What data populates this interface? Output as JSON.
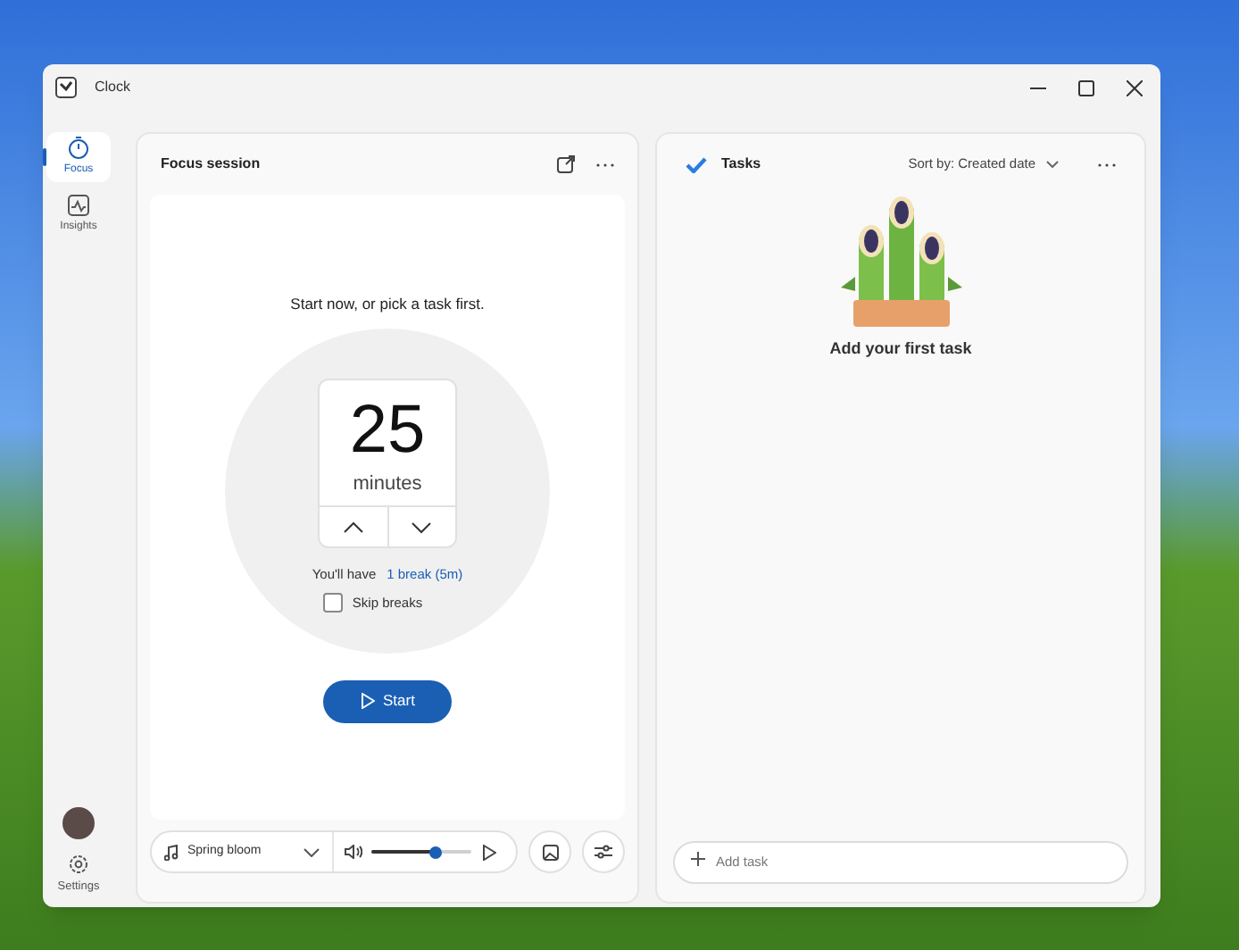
{
  "window": {
    "title": "Clock"
  },
  "nav": [
    {
      "label": "Focus",
      "selected": true
    },
    {
      "label": "Insights",
      "selected": false
    }
  ],
  "nav_footer": {
    "settings_label": "Settings"
  },
  "focus": {
    "title": "Focus session",
    "prompt": "Start now, or pick a task first.",
    "minutes": "25",
    "unit": "minutes",
    "break_prefix": "You'll have",
    "break_link": "1 break (5m)",
    "skip_breaks": {
      "label": "Skip breaks",
      "checked": false
    },
    "start_label": "Start"
  },
  "player": {
    "track": "Spring bloom",
    "volume": {
      "level": 0.65
    }
  },
  "tasks": {
    "title": "Tasks",
    "sort": "Sort by: Created date",
    "empty": "Add your first task",
    "add_placeholder": "Add task"
  }
}
